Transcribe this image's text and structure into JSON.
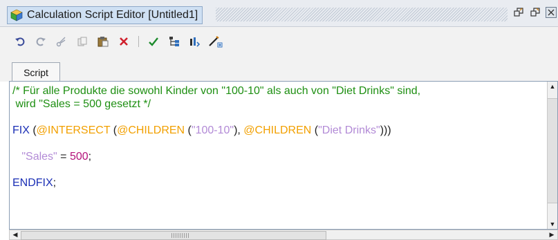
{
  "window": {
    "title": "Calculation Script Editor [Untitled1]",
    "app_icon": "cube-icon",
    "controls": [
      "restore-icon",
      "maximize-icon",
      "close-icon"
    ]
  },
  "toolbar": {
    "buttons": [
      {
        "name": "undo-icon"
      },
      {
        "name": "redo-icon"
      },
      {
        "name": "cut-icon"
      },
      {
        "name": "copy-icon"
      },
      {
        "name": "paste-icon"
      },
      {
        "name": "delete-icon"
      },
      {
        "name": "check-syntax-icon"
      },
      {
        "name": "outline-icon"
      },
      {
        "name": "bar-chart-icon"
      },
      {
        "name": "insert-function-icon"
      }
    ]
  },
  "tabs": [
    {
      "label": "Script",
      "active": true
    }
  ],
  "editor": {
    "line1": "/* Für alle Produkte die sowohl Kinder von \"100-10\" als auch von \"Diet Drinks\" sind,",
    "line2": " wird \"Sales = 500 gesetzt */",
    "fix": "FIX",
    "paren_open": " (",
    "intersect": "@INTERSECT",
    "sp1": " (",
    "children1": "@CHILDREN",
    "sp2": " (",
    "str1": "\"100-10\"",
    "close1": "), ",
    "children2": "@CHILDREN",
    "sp3": " (",
    "str2": "\"Diet Drinks\"",
    "close2": ")))",
    "sales_indent": "   ",
    "sales_str": "\"Sales\"",
    "eq": " = ",
    "sales_val": "500",
    "semi": ";",
    "endfix": "ENDFIX",
    "endfix_semi": ";"
  },
  "colors": {
    "comment": "#1e8f12",
    "keyword": "#1b2fb5",
    "function": "#f2a000",
    "string": "#b28ad6",
    "number": "#b3127a"
  }
}
